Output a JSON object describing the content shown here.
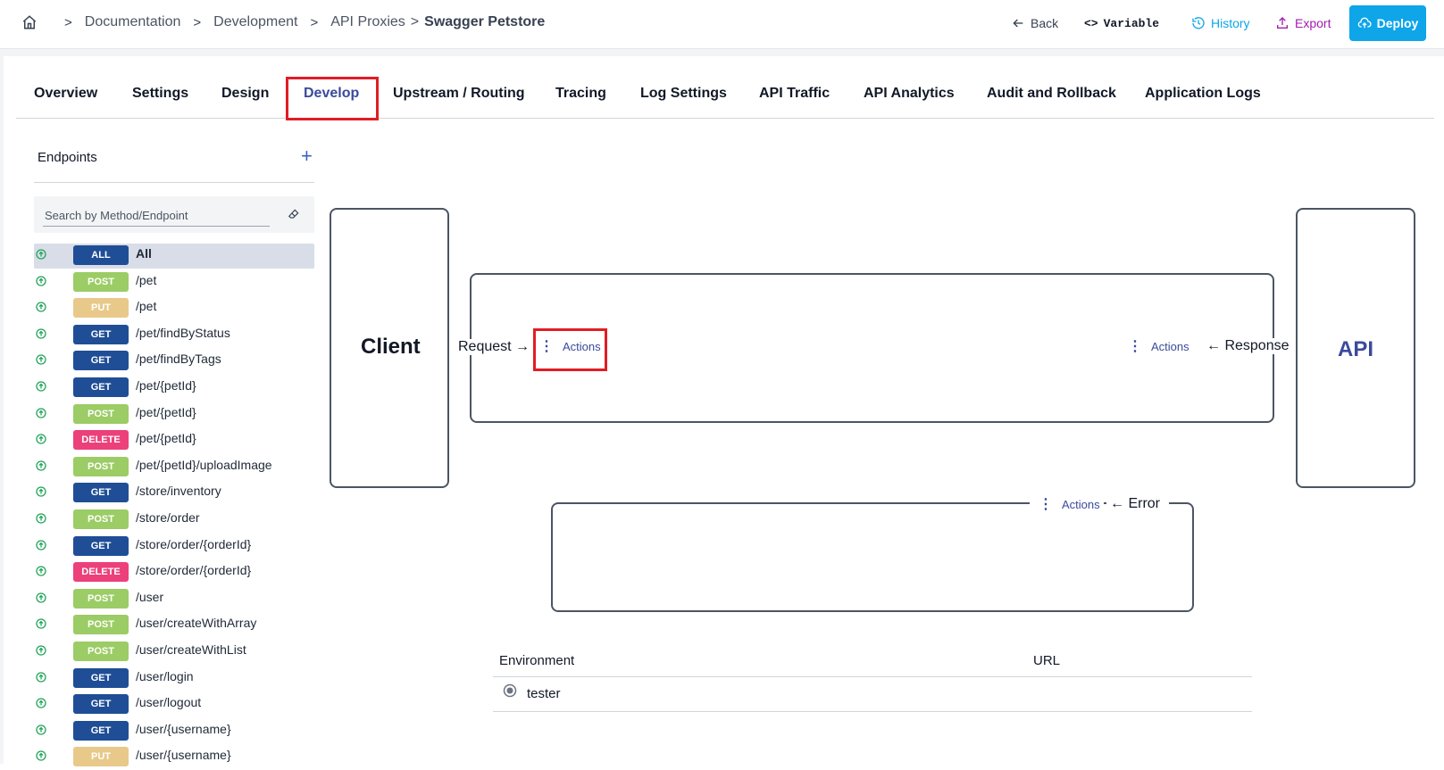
{
  "breadcrumb": [
    "Documentation",
    "Development",
    "API Proxies",
    "Swagger Petstore"
  ],
  "header_actions": {
    "back": "Back",
    "variable": "Variable",
    "history": "History",
    "export": "Export",
    "deploy": "Deploy"
  },
  "tabs": [
    "Overview",
    "Settings",
    "Design",
    "Develop",
    "Upstream / Routing",
    "Tracing",
    "Log Settings",
    "API Traffic",
    "API Analytics",
    "Audit and Rollback",
    "Application Logs"
  ],
  "active_tab": "Develop",
  "sidebar": {
    "title": "Endpoints",
    "add_icon": "plus-icon",
    "search_placeholder": "Search by Method/Endpoint",
    "endpoints": [
      {
        "method": "ALL",
        "path": "All",
        "selected": true
      },
      {
        "method": "POST",
        "path": "/pet"
      },
      {
        "method": "PUT",
        "path": "/pet"
      },
      {
        "method": "GET",
        "path": "/pet/findByStatus"
      },
      {
        "method": "GET",
        "path": "/pet/findByTags"
      },
      {
        "method": "GET",
        "path": "/pet/{petId}"
      },
      {
        "method": "POST",
        "path": "/pet/{petId}"
      },
      {
        "method": "DELETE",
        "path": "/pet/{petId}"
      },
      {
        "method": "POST",
        "path": "/pet/{petId}/uploadImage"
      },
      {
        "method": "GET",
        "path": "/store/inventory"
      },
      {
        "method": "POST",
        "path": "/store/order"
      },
      {
        "method": "GET",
        "path": "/store/order/{orderId}"
      },
      {
        "method": "DELETE",
        "path": "/store/order/{orderId}"
      },
      {
        "method": "POST",
        "path": "/user"
      },
      {
        "method": "POST",
        "path": "/user/createWithArray"
      },
      {
        "method": "POST",
        "path": "/user/createWithList"
      },
      {
        "method": "GET",
        "path": "/user/login"
      },
      {
        "method": "GET",
        "path": "/user/logout"
      },
      {
        "method": "GET",
        "path": "/user/{username}"
      },
      {
        "method": "PUT",
        "path": "/user/{username}"
      }
    ]
  },
  "method_colors": {
    "ALL": "#1f4e96",
    "GET": "#1f4e96",
    "POST": "#9ccc65",
    "PUT": "#e8c98a",
    "DELETE": "#ec407a"
  },
  "flow": {
    "client": "Client",
    "api": "API",
    "request": "Request →",
    "response": "← Response",
    "error": "← Error",
    "actions_label": "Actions"
  },
  "environment_table": {
    "headers": [
      "Environment",
      "URL"
    ],
    "rows": [
      {
        "environment": "tester",
        "url": ""
      }
    ]
  },
  "colors": {
    "accent": "#3b4a9c",
    "deploy": "#0ea5e9",
    "history": "#0ea5e9",
    "export": "#a21caf",
    "highlight": "#e11d24"
  }
}
